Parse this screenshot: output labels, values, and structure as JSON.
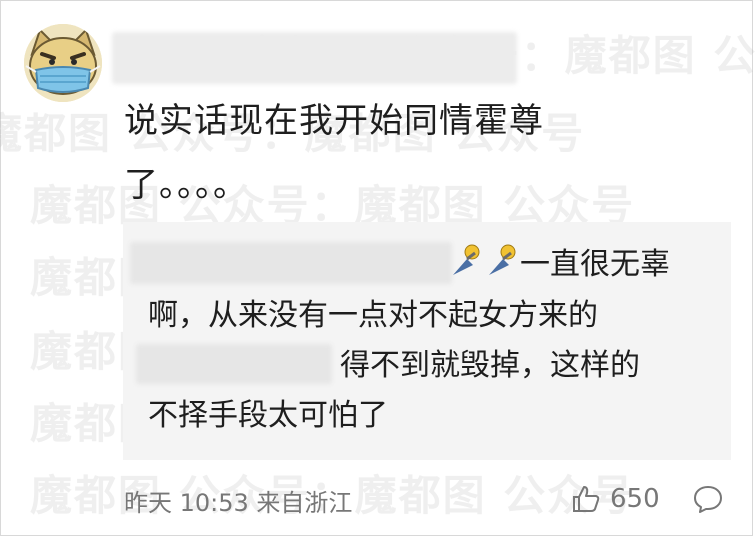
{
  "comment": {
    "lines": [
      "说实话现在我开始同情霍尊",
      "了。。。。"
    ]
  },
  "reply": {
    "line1_tail": "一直很无辜",
    "line2": "啊，从来没有一点对不起女方来的",
    "line3_tail": "得不到就毁掉，这样的",
    "line4": "不择手段太可怕了"
  },
  "footer": {
    "meta": "昨天 10:53 来自浙江",
    "likes": "650"
  },
  "watermark": {
    "text": "魔都图 公众号：魔都图 公众号",
    "short": "魔都图"
  },
  "colors": {
    "text": "#1e1e1e",
    "meta": "#777777",
    "reply_bg": "#f4f4f4"
  }
}
